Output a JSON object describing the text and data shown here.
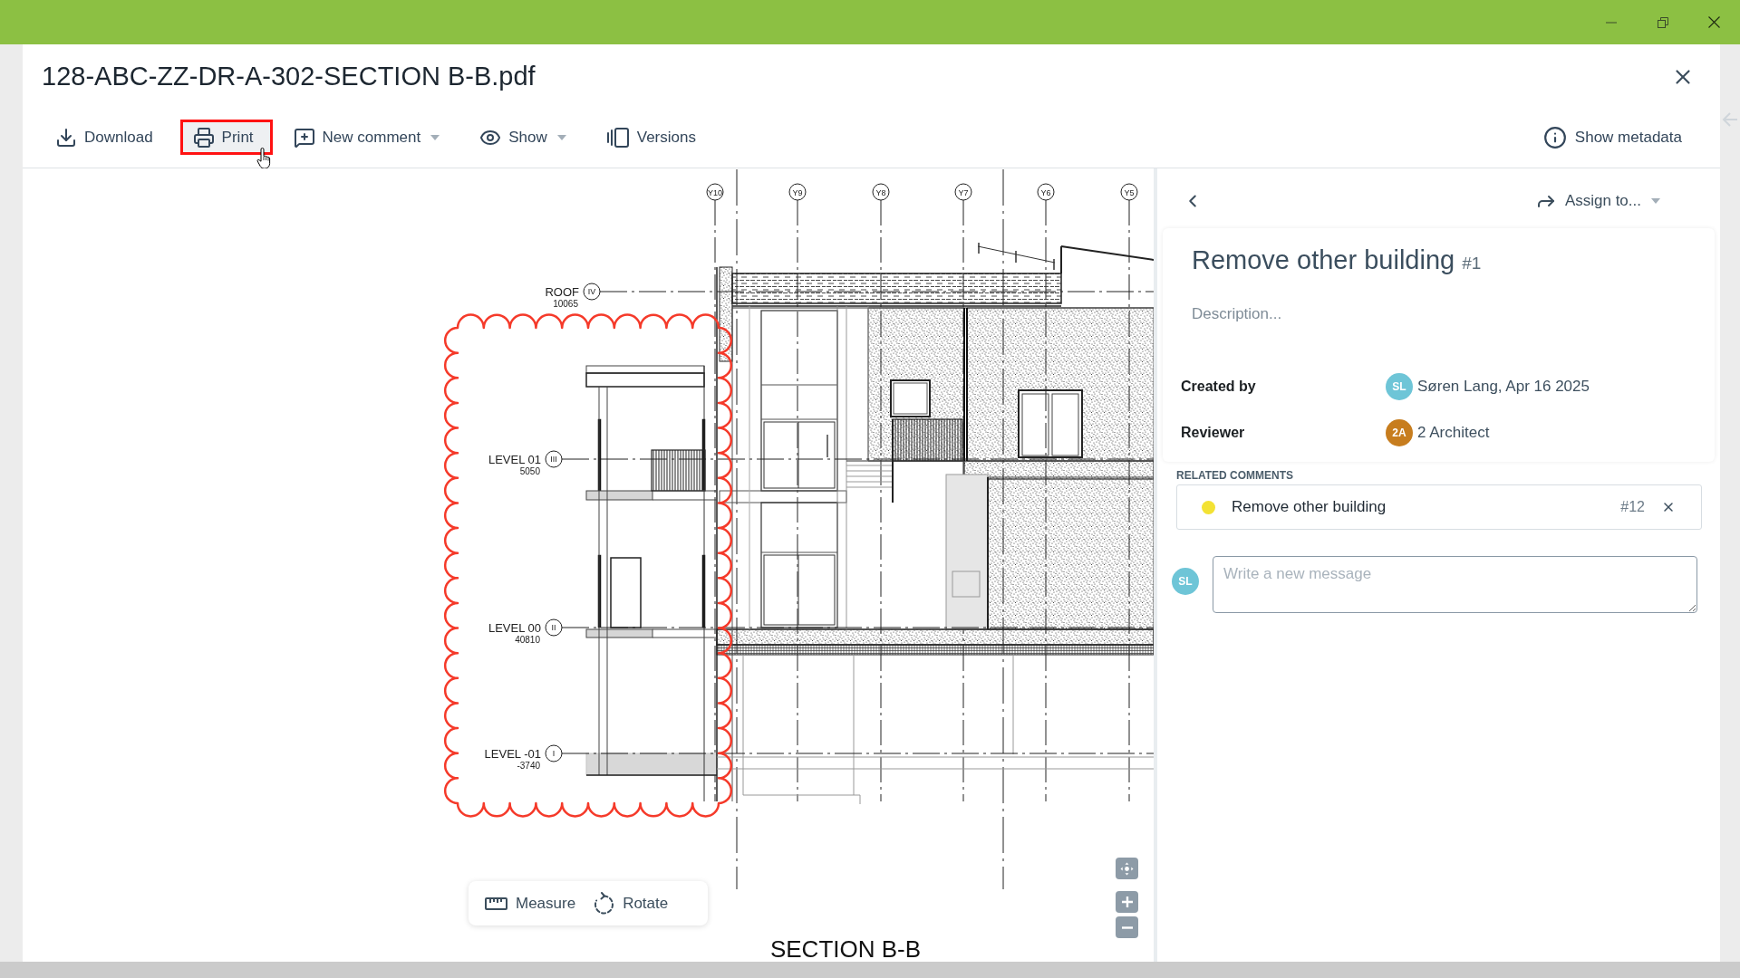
{
  "dialog": {
    "title": "128-ABC-ZZ-DR-A-302-SECTION B-B.pdf"
  },
  "toolbar": {
    "items": [
      {
        "label": "Download",
        "dropdown": false,
        "highlighted": false
      },
      {
        "label": "Print",
        "dropdown": false,
        "highlighted": true
      },
      {
        "label": "New comment",
        "dropdown": true,
        "highlighted": false
      },
      {
        "label": "Show",
        "dropdown": true,
        "highlighted": false
      },
      {
        "label": "Versions",
        "dropdown": false,
        "highlighted": false
      }
    ],
    "metadata_button": "Show metadata"
  },
  "viewer": {
    "drawing": {
      "grid_labels": [
        "Y10",
        "Y9",
        "Y8",
        "Y7",
        "Y6",
        "Y5"
      ],
      "levels": [
        {
          "name": "ROOF",
          "numeral": "IV",
          "elevation": "10065"
        },
        {
          "name": "LEVEL 01",
          "numeral": "III",
          "elevation": "5050"
        },
        {
          "name": "LEVEL 00",
          "numeral": "II",
          "elevation": "40810"
        },
        {
          "name": "LEVEL -01",
          "numeral": "I",
          "elevation": "-3740"
        }
      ],
      "title": "SECTION B-B"
    },
    "tools": [
      "Measure",
      "Rotate"
    ]
  },
  "comment_panel": {
    "assign_button": "Assign to...",
    "title": "Remove other building",
    "number": "#1",
    "description": {
      "placeholder": "Description..."
    },
    "fields": [
      {
        "label": "Created by",
        "avatar": "SL",
        "color": "#6ec5d7",
        "value": "Søren Lang, Apr 16 2025"
      },
      {
        "label": "Reviewer",
        "avatar": "2A",
        "color": "#c77d1e",
        "value": "2 Architect"
      }
    ],
    "related_heading": "RELATED COMMENTS",
    "related_comments": [
      {
        "title": "Remove other building",
        "number": "#12",
        "color": "#f3e234"
      }
    ],
    "composer": {
      "avatar": "SL",
      "placeholder": "Write a new message"
    }
  }
}
